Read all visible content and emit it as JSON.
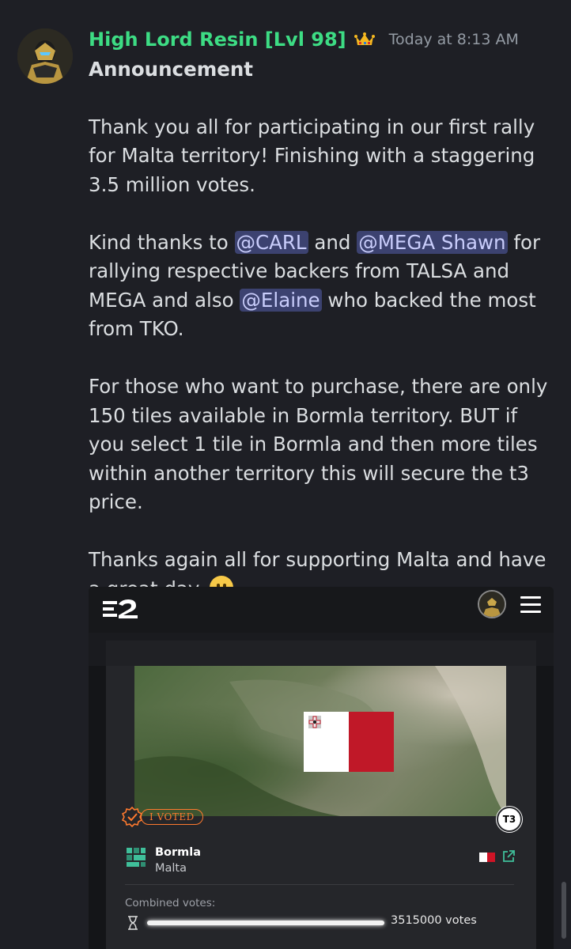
{
  "author": {
    "name": "High Lord Resin [Lvl 98]",
    "timestamp": "Today at 8:13 AM",
    "badge_icon": "crown-icon",
    "name_color": "#3ddc84"
  },
  "message": {
    "title": "Announcement",
    "para1": "Thank you all for participating in our first rally for Malta territory! Finishing with a staggering 3.5 million votes.",
    "para2_a": "Kind thanks to ",
    "mention_carl": "@CARL",
    "para2_b": " and ",
    "mention_mega": "@MEGA Shawn",
    "para2_c": " for rallying respective backers from TALSA and MEGA and also ",
    "mention_elaine": "@Elaine",
    "para2_d": " who backed the most from TKO.",
    "para3": "For those who want to purchase, there are only 150 tiles available in Bormla territory. BUT if you select 1 tile in Bormla and then more tiles within another territory this will secure the t3 price.",
    "para4": "Thanks again all for supporting Malta and have a great day.",
    "emoji": "slightly-smiling-face"
  },
  "embed": {
    "logo": "E2",
    "voted_label": "I VOTED",
    "tier": "T3",
    "territory_name": "Bormla",
    "country": "Malta",
    "combined_label": "Combined votes:",
    "votes_text": "3515000 votes",
    "vote_progress": 1.0,
    "flag_colors": [
      "#ffffff",
      "#cf1426"
    ]
  }
}
